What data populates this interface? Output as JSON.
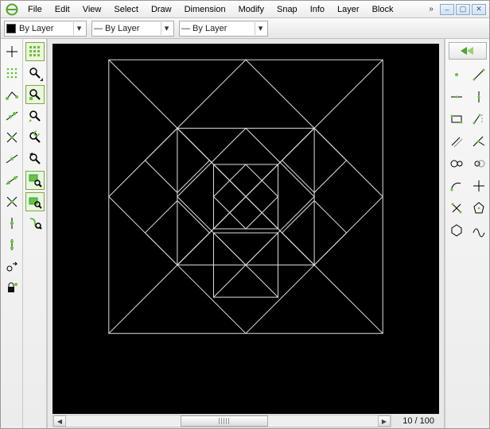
{
  "menu": {
    "items": [
      "File",
      "Edit",
      "View",
      "Select",
      "Draw",
      "Dimension",
      "Modify",
      "Snap",
      "Info",
      "Layer",
      "Block"
    ]
  },
  "window_controls": {
    "minimize": "–",
    "maximize": "▢",
    "close": "✕",
    "overflow": "»"
  },
  "properties": {
    "color_label": "By Layer",
    "width_label": "— By Layer",
    "linetype_label": "— By Layer"
  },
  "accent": "#6fbf3f",
  "status": {
    "selection_count": "10 / 100"
  },
  "left_tools": {
    "col1": [
      "snap-free-icon",
      "snap-grid-icon",
      "snap-endpoint-icon",
      "snap-on-entity-icon",
      "snap-center-icon",
      "snap-middle-icon",
      "snap-distance-icon",
      "snap-intersection-icon",
      "restrict-nothing-icon",
      "restrict-ortho-icon",
      "relative-zero-icon",
      "lock-relative-zero-icon"
    ],
    "col2": [
      "grid-icon",
      "zoom-redraw-icon",
      "zoom-in-icon",
      "zoom-out-icon",
      "zoom-auto-icon",
      "zoom-previous-icon",
      "zoom-window-icon",
      "zoom-pan-icon",
      "zoom-selection-icon"
    ]
  },
  "right_panel": {
    "back_label": "◀",
    "tools": [
      "tool-point-icon",
      "tool-line-icon",
      "tool-hline-icon",
      "tool-vline-icon",
      "tool-rect-icon",
      "tool-polyline-icon",
      "tool-parallel-icon",
      "tool-bisector-icon",
      "tool-circle-icon",
      "tool-circle2p-icon",
      "tool-arc-icon",
      "tool-tangent-icon",
      "tool-angle-icon",
      "tool-polygon-icon",
      "tool-hexagon-icon",
      "tool-spline-icon"
    ]
  }
}
